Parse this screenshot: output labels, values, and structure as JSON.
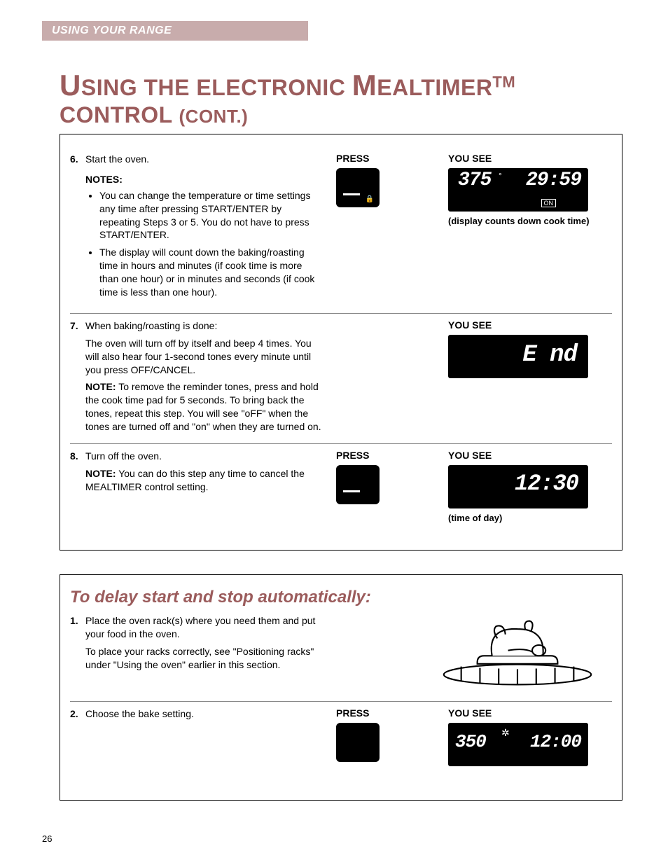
{
  "section_tab": "USING YOUR RANGE",
  "title_pre": "U",
  "title_1": "SING THE ELECTRONIC ",
  "title_big": "M",
  "title_2": "EALTIMER",
  "title_tm": "TM",
  "title_3": " CONTROL ",
  "title_cont": "(CONT.)",
  "labels": {
    "press": "PRESS",
    "you_see": "YOU SEE",
    "notes": "NOTES:",
    "note_inline": "NOTE:"
  },
  "steps": {
    "s6": {
      "num": "6.",
      "text": "Start the oven.",
      "note1": "You can change the temperature or time settings any time after pressing START/ENTER by repeating Steps 3 or 5. You do not have to press START/ENTER.",
      "note2": "The display will count down the baking/roasting time in hours and minutes (if cook time is more than one hour) or in minutes and seconds (if cook time is less than one hour).",
      "display_temp": "375",
      "display_deg": "°",
      "display_time": "29:59",
      "display_on": "ON",
      "caption": "(display counts down cook time)"
    },
    "s7": {
      "num": "7.",
      "text": "When baking/roasting is done:",
      "p1": "The oven will turn off by itself and beep 4 times. You will also hear four 1-second tones every minute until you press OFF/CANCEL.",
      "p2a": " To remove the reminder tones, press and hold the cook time pad for 5 seconds. To bring back the tones, repeat this step. You will see \"oFF\" when the tones are turned off and \"on\" when they are turned on.",
      "display_end": "E nd"
    },
    "s8": {
      "num": "8.",
      "text": "Turn off the oven.",
      "p1": " You can do this step any time to cancel the MEALTIMER control setting.",
      "display_tod": "12:30",
      "caption": "(time of day)"
    }
  },
  "box2": {
    "subtitle": "To delay start and stop automatically:",
    "s1": {
      "num": "1.",
      "text": "Place the oven rack(s) where you need them and put your food in the oven.",
      "p1": "To place your racks correctly, see \"Positioning racks\" under \"Using the oven\" earlier in this section."
    },
    "s2": {
      "num": "2.",
      "text": "Choose the bake setting.",
      "display_temp": "350",
      "display_star": "✲",
      "display_time": "12:00"
    }
  },
  "page_num": "26"
}
